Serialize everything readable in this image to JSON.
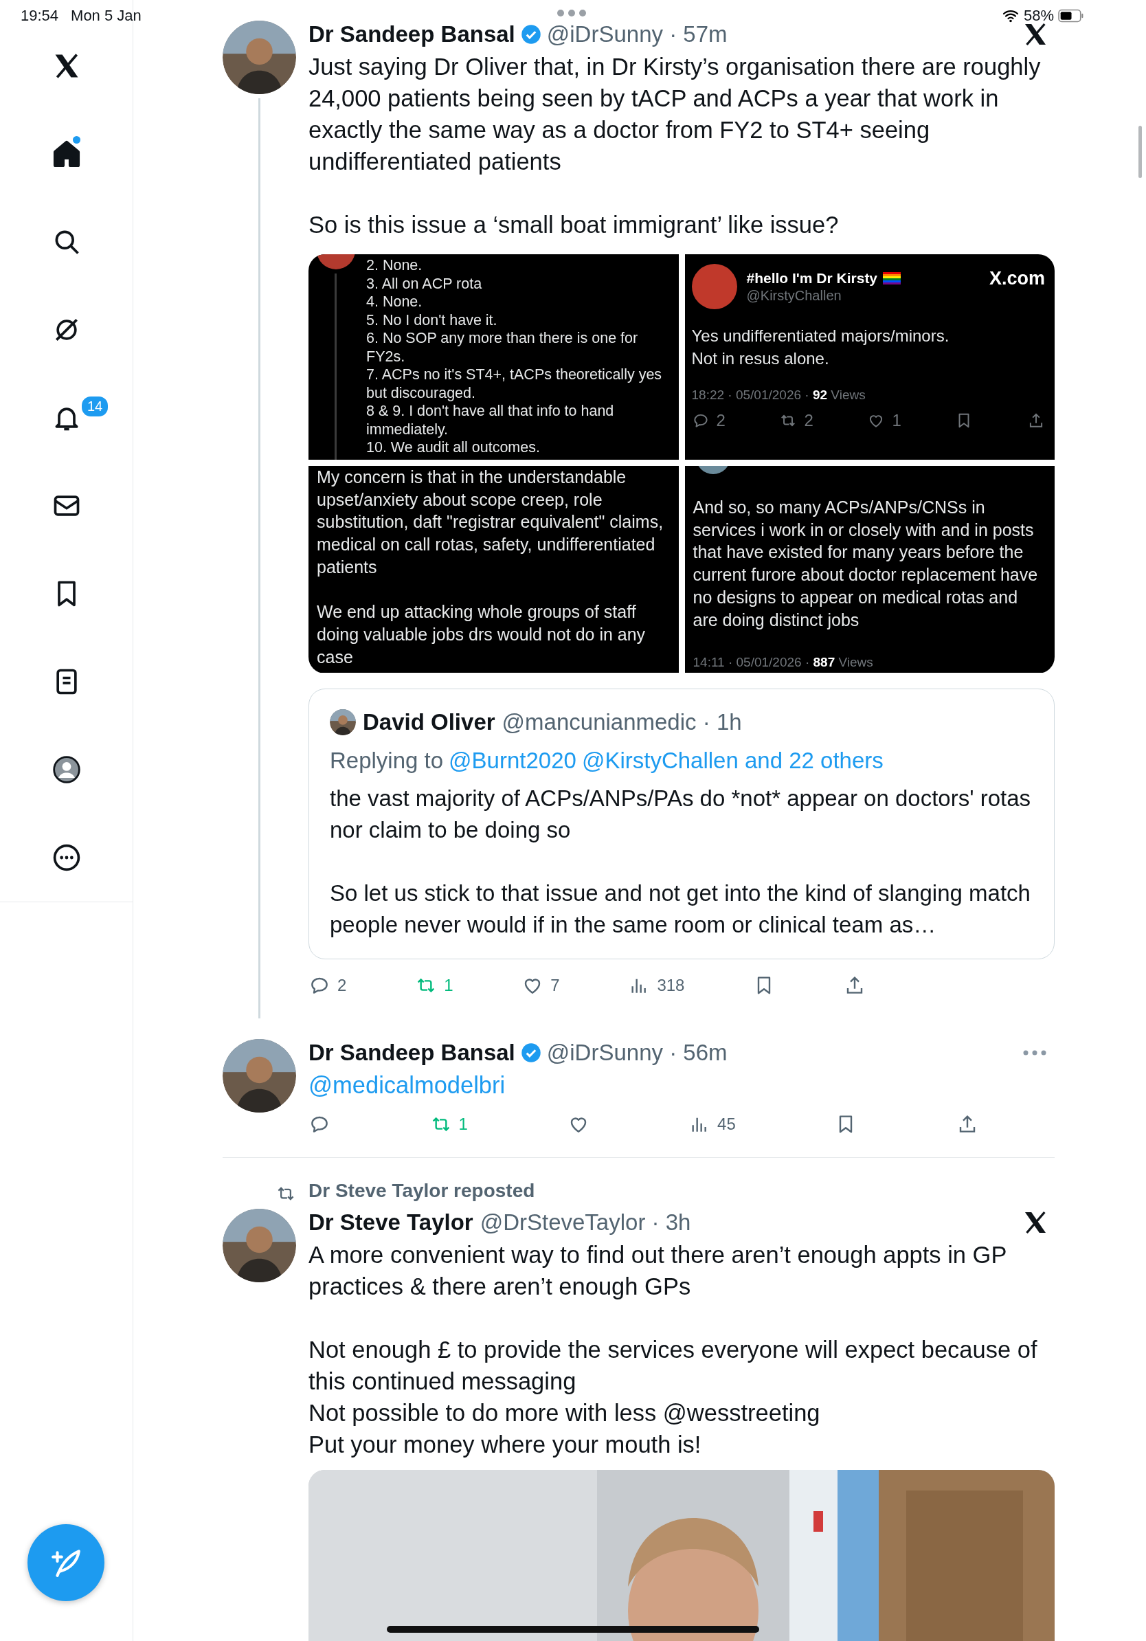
{
  "status_bar": {
    "time": "19:54",
    "date": "Mon 5 Jan",
    "battery": "58%"
  },
  "sidebar": {
    "items": [
      {
        "kind": "logo",
        "selected": false,
        "dot": false
      },
      {
        "kind": "home",
        "selected": true,
        "dot": true
      },
      {
        "kind": "search",
        "selected": false,
        "dot": false
      },
      {
        "kind": "grok",
        "selected": false,
        "dot": false
      },
      {
        "kind": "notifications",
        "selected": false,
        "dot": false,
        "badge": "14"
      },
      {
        "kind": "messages",
        "selected": false,
        "dot": false
      },
      {
        "kind": "bookmarks",
        "selected": false,
        "dot": false
      },
      {
        "kind": "lists",
        "selected": false,
        "dot": false
      },
      {
        "kind": "profile",
        "selected": false,
        "dot": false
      },
      {
        "kind": "more",
        "selected": false,
        "dot": false
      }
    ]
  },
  "tweets": [
    {
      "author": "Dr Sandeep Bansal",
      "verified": true,
      "meta": "@iDrSunny · 57m",
      "corner": {
        "kind": "x-logo"
      },
      "thread_line": true,
      "body": [
        {
          "kind": "text",
          "lines": [
            "Just saying Dr Oliver that, in Dr Kirsty’s organisation there are roughly 24,000 patients being seen by tACP and ACPs a year that work in exactly the same way as a doctor from FY2 to ST4+ seeing undifferentiated patients"
          ]
        },
        {
          "kind": "text",
          "lines": [
            "So is this issue a ‘small boat immigrant’ like issue?"
          ]
        }
      ],
      "media": [
        {
          "kind": "thread",
          "lines": [
            "2. None.",
            "3. All on ACP rota",
            "4. None.",
            "5. No I don't have it.",
            "6. No SOP any more than there is one for FY2s.",
            "7. ACPs no it's ST4+, tACPs theoretically yes but discouraged.",
            "8 & 9. I don't have all that info to hand immediately.",
            "10. We audit all outcomes."
          ]
        },
        {
          "kind": "card",
          "author": "#hello I'm Dr Kirsty",
          "flag": true,
          "handle": "@KirstyChallen",
          "brand": "X.com",
          "lines": [
            "Yes undifferentiated majors/minors.",
            "Not in resus alone."
          ],
          "stats": "18:22 · 05/01/2026 · **92** Views",
          "actions": [
            {
              "kind": "reply",
              "count": "2",
              "on": false
            },
            {
              "kind": "repost",
              "count": "2",
              "on": false
            },
            {
              "kind": "like",
              "count": "1",
              "on": false
            },
            {
              "kind": "bookmark",
              "on": false
            },
            {
              "kind": "share",
              "on": false
            }
          ]
        },
        {
          "kind": "text",
          "paragraphs": [
            "My concern is that in the understandable upset/anxiety about scope creep, role substitution, daft \"registrar equivalent\" claims, medical on call rotas, safety, undifferentiated patients",
            "We end up attacking whole groups of staff doing valuable jobs drs would not do in any case"
          ]
        },
        {
          "kind": "continued",
          "paragraphs": [
            "And so, so many ACPs/ANPs/CNSs in services i work in or closely with and in posts that have existed for many years before the current furore about doctor replacement have no designs to appear on medical rotas and are doing distinct jobs"
          ],
          "stats": "14:11 · 05/01/2026 · **887** Views"
        }
      ],
      "quote": {
        "author": "David Oliver",
        "meta": "@mancunianmedic · 1h",
        "replying_prefix": "Replying to",
        "replying_links": [
          "@Burnt2020",
          "@KirstyChallen and 22 others"
        ],
        "paragraphs": [
          "the vast majority of ACPs/ANPs/PAs do *not* appear on doctors' rotas nor claim to be doing so",
          "So let us stick to that issue and not get into the kind of slanging match people never would if in the same room or clinical team as…"
        ]
      },
      "actions": [
        {
          "kind": "reply",
          "count": "2",
          "on": false
        },
        {
          "kind": "repost",
          "count": "1",
          "on": true
        },
        {
          "kind": "like",
          "count": "7",
          "on": false
        },
        {
          "kind": "views",
          "count": "318",
          "on": false
        },
        {
          "kind": "bookmark",
          "on": false
        },
        {
          "kind": "share",
          "on": false
        }
      ]
    },
    {
      "author": "Dr Sandeep Bansal",
      "verified": true,
      "meta": "@iDrSunny · 56m",
      "corner": {
        "kind": "more"
      },
      "thread_line": false,
      "body": [
        {
          "kind": "link",
          "lines": [
            "@medicalmodelbri"
          ]
        }
      ],
      "actions": [
        {
          "kind": "reply",
          "on": false
        },
        {
          "kind": "repost",
          "count": "1",
          "on": true
        },
        {
          "kind": "like",
          "on": false
        },
        {
          "kind": "views",
          "count": "45",
          "on": false
        },
        {
          "kind": "bookmark",
          "on": false
        },
        {
          "kind": "share",
          "on": false
        }
      ]
    },
    {
      "repost_by": "Dr Steve Taylor reposted",
      "author": "Dr Steve Taylor",
      "verified": false,
      "meta": "@DrSteveTaylor · 3h",
      "corner": {
        "kind": "x-logo"
      },
      "thread_line": false,
      "body": [
        {
          "kind": "text",
          "lines": [
            "A more convenient way to find out there aren’t enough appts in GP practices & there aren’t enough GPs"
          ]
        },
        {
          "kind": "text",
          "lines": [
            "Not enough £ to provide the services everyone will expect because of this continued messaging",
            "Not possible to do more with less @wesstreeting",
            "Put your money where your mouth is!"
          ]
        }
      ],
      "image": {
        "kind": "picture"
      }
    }
  ]
}
